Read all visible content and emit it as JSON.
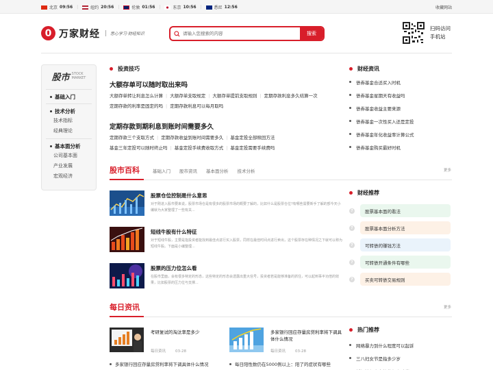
{
  "topbar": {
    "clocks": [
      {
        "city": "北京",
        "time": "09:56"
      },
      {
        "city": "纽约",
        "time": "20:56"
      },
      {
        "city": "伦敦",
        "time": "01:56"
      },
      {
        "city": "东京",
        "time": "10:56"
      },
      {
        "city": "悉尼",
        "time": "12:56"
      }
    ],
    "favorite": "收藏网站"
  },
  "header": {
    "logo_mark": "0",
    "logo_name": "万家财经",
    "slogan": "悉心学习·财经知识",
    "search_placeholder": "请输入您搜索的内容",
    "search_button": "搜索",
    "qr_text_1": "扫码访问",
    "qr_text_2": "手机站"
  },
  "leftnav": {
    "head_big": "股市",
    "head_small_1": "STOCK",
    "head_small_2": "MARKET",
    "sections": [
      {
        "title": "基础入门",
        "items": []
      },
      {
        "title": "技术分析",
        "items": [
          "技术指标",
          "经典理论"
        ]
      },
      {
        "title": "基本面分析",
        "items": [
          "公司基本面",
          "产业发展",
          "宏观经济"
        ]
      }
    ]
  },
  "tips": {
    "section_title": "投资技巧",
    "block1_title": "大额存单可以随时取出来吗",
    "block1_links_row1": [
      "大额存单转让利息怎么计算",
      "大额存单支取规定",
      "大额存单提前支取规则",
      "定期存款利息多久结算一次"
    ],
    "block1_links_row2": [
      "定期存款的利率是固定的吗",
      "定期存款利息可以每月取吗"
    ],
    "block2_title": "定期存款到期利息到账时间需要多久",
    "block2_links_row1": [
      "定期存款三个支取方式",
      "定期存款收益到账时间需要多久",
      "基金定投全部赎回方法"
    ],
    "block2_links_row2": [
      "基金三年定投可以随时终止吗",
      "基金定投手续费收取方式",
      "基金定投需要手续费吗"
    ]
  },
  "stock": {
    "title": "股市百科",
    "tabs": [
      "基础入门",
      "股市资讯",
      "基本面分析",
      "技术分析"
    ],
    "more": "更多",
    "articles": [
      {
        "title": "股票仓位控制是什么意思",
        "desc": "对于刚进入股市要来说，股票市场仓是有很多的股票市场的概要了解的，比如什么是股票仓位?有哪些需要新手了解的部今天小编就为大家整理了一些有关..."
      },
      {
        "title": "短线牛股有什么特征",
        "desc": "对于短线牛股，主要是指投资者能找到最佳点进行买入股票，同样在最佳时间点进行卖出，这个股票存在种情况之下就可以称为短线牛股。下面是小编整理..."
      },
      {
        "title": "股票的压力位怎么看",
        "desc": "在股市里面，会有很多特定的形态，这些特定的形态会透露出重大信号，投资者若是能够准备的抓住，可以起到事半功倍的效果，比如股票的压力位与支撑..."
      }
    ]
  },
  "daily": {
    "title": "每日资讯",
    "more": "更多",
    "items": [
      {
        "title": "考研复试的淘汰率是多少",
        "tag": "每日资讯",
        "date": "03-28"
      },
      {
        "title": "多家银行回应存量房贷利率将下调具体什么情况",
        "tag": "每日资讯",
        "date": "03-28"
      }
    ],
    "links": [
      "多家银行回应存量房贷利率将下调具体什么情况",
      "每日阳性数仍在5000例以上：阳了的症状有哪些"
    ]
  },
  "news": {
    "title": "财经资讯",
    "items": [
      "债券基金合适买入时机",
      "债券基金星期天有收益吗",
      "债券基金收益主要来源",
      "债券基金一次性买入还是定投",
      "债券基金年化收益率计算公式",
      "债券基金购买最好时机"
    ]
  },
  "recommend": {
    "title": "财经推荐",
    "items": [
      {
        "label": "股票基本面的看法",
        "color": "#eaf7ee"
      },
      {
        "label": "股票基本面分析方法",
        "color": "#fdf1e6"
      },
      {
        "label": "可转债的赚钱方法",
        "color": "#eaf3fb"
      },
      {
        "label": "可转债开通条件有哪些",
        "color": "#eaf7ee"
      },
      {
        "label": "买卖可转债交易规则",
        "color": "#fdf1e6"
      }
    ]
  },
  "hot": {
    "title": "热门推荐",
    "items": [
      "网络暴力到什么程度可以起诉",
      "三八妇女节是指多少岁",
      "婚姻法规定出轨的怎么赔偿"
    ]
  },
  "colors": {
    "brand": "#d81e2a"
  }
}
